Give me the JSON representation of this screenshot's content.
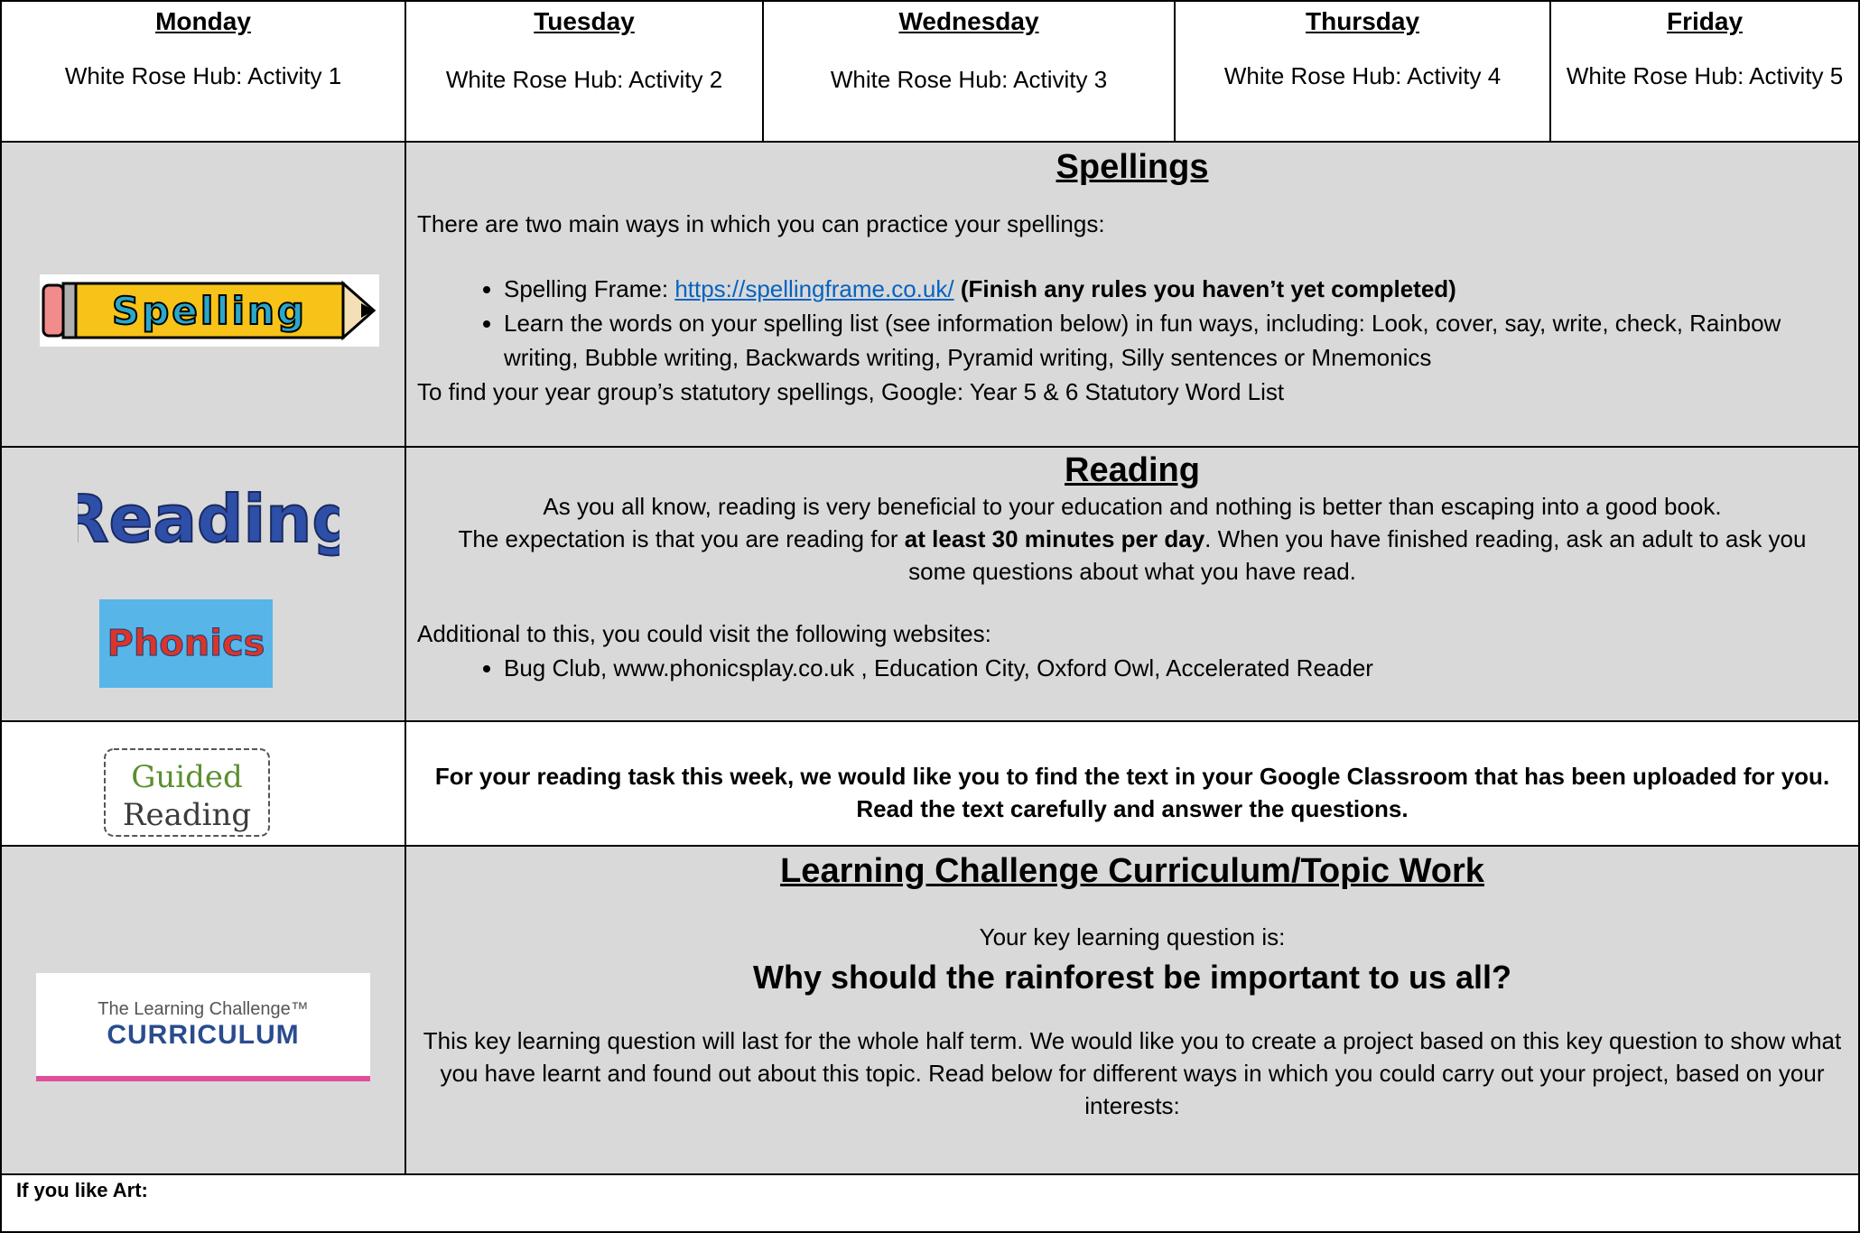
{
  "days": [
    {
      "name": "Monday",
      "activity": "White Rose Hub: Activity 1"
    },
    {
      "name": "Tuesday",
      "activity": "White Rose Hub: Activity 2"
    },
    {
      "name": "Wednesday",
      "activity": "White Rose Hub: Activity 3"
    },
    {
      "name": "Thursday",
      "activity": "White Rose Hub: Activity 4"
    },
    {
      "name": "Friday",
      "activity": "White Rose Hub: Activity 5"
    }
  ],
  "spellings": {
    "logo_text": "Spelling",
    "title": "Spellings",
    "intro": "There are two main ways in which you can practice your spellings:",
    "bullet1_prefix": "Spelling Frame: ",
    "bullet1_link": "https://spellingframe.co.uk/",
    "bullet1_bold": "(Finish any rules you haven’t yet completed)",
    "bullet2": "Learn the words on your spelling list (see information below) in fun ways, including: Look, cover, say, write, check, Rainbow writing, Bubble writing, Backwards writing, Pyramid writing, Silly sentences or Mnemonics",
    "footer": "To find your year group’s statutory spellings, Google: Year 5 & 6 Statutory Word List"
  },
  "reading": {
    "logo_reading": "Reading",
    "logo_phonics": "Phonics",
    "title": "Reading",
    "line1": "As you all know, reading is very beneficial to your education and nothing is better than escaping into a good book.",
    "line2_prefix": "The expectation is that you are reading for ",
    "line2_bold": "at least 30 minutes per day",
    "line2_suffix": ".  When you have finished reading, ask an adult to ask you some questions about what you have read.",
    "additional": "Additional to this, you could visit the following websites:",
    "bullet": "Bug Club, www.phonicsplay.co.uk , Education City, Oxford Owl, Accelerated Reader"
  },
  "guided": {
    "logo_line1": "Guided",
    "logo_line2": "Reading",
    "line1": "For your reading task this week, we would like you to find the text in your Google Classroom that has been uploaded for you.",
    "line2": "Read the text carefully and answer the questions."
  },
  "topic": {
    "logo_small": "The Learning Challenge™",
    "logo_big": "CURRICULUM",
    "title": "Learning Challenge Curriculum/Topic Work",
    "question_intro": "Your key learning question is:",
    "question": "Why should the rainforest be important to us all?",
    "body": "This key learning question will last for the whole half term.  We would like you to create a project based on this key question to show what you have learnt and found out about this topic. Read below for different ways in which you could carry out your project, based on your interests:"
  },
  "art": {
    "label": "If you like Art:"
  },
  "colors": {
    "gray": "#d9d9d9",
    "link": "#0563c1"
  }
}
